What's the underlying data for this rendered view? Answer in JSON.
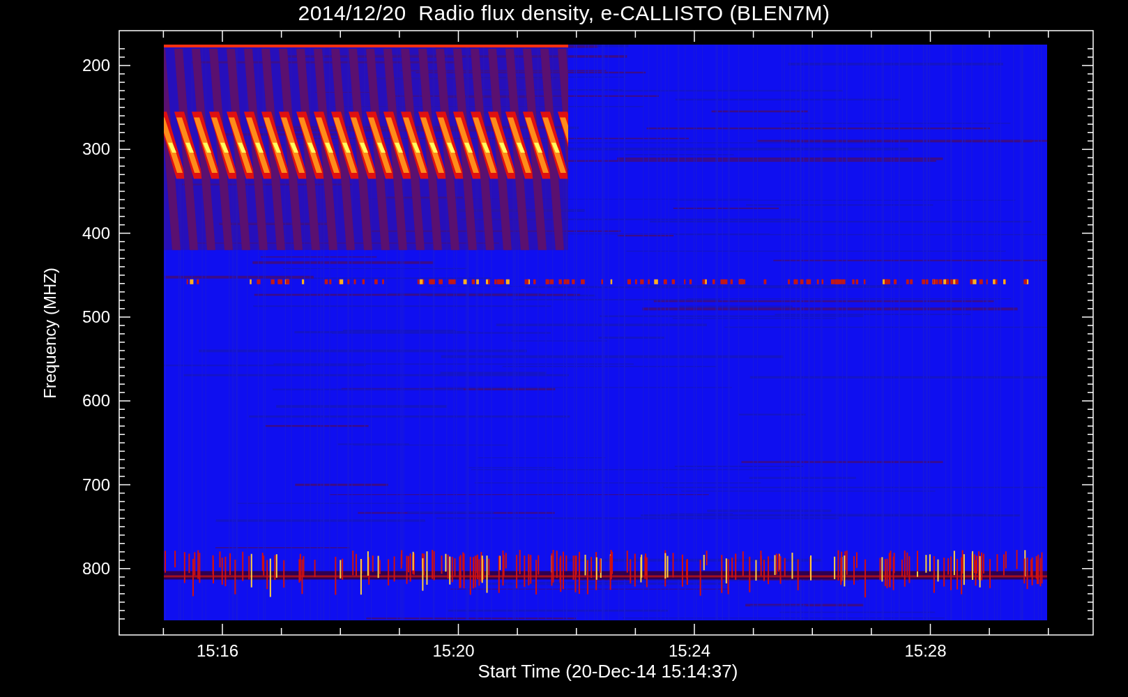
{
  "title": "2014/12/20  Radio flux density, e-CALLISTO (BLEN7M)",
  "y_axis": {
    "label": "Frequency (MHZ)",
    "ticks": [
      "200",
      "300",
      "400",
      "500",
      "600",
      "700",
      "800"
    ]
  },
  "x_axis": {
    "label": "Start Time (20-Dec-14 15:14:37)",
    "ticks": [
      "15:16",
      "15:20",
      "15:24",
      "15:28"
    ]
  }
}
